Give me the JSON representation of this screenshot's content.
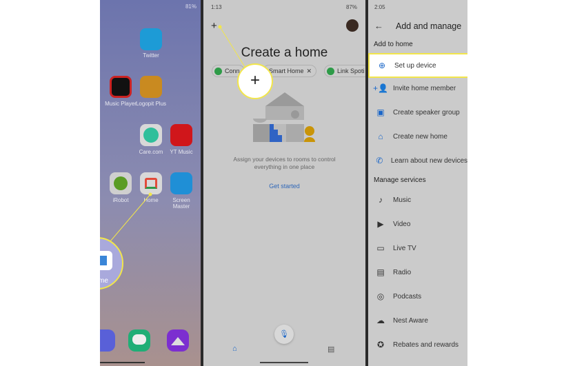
{
  "panel1": {
    "status": "81%",
    "apps": [
      {
        "label": "Twitter",
        "color": "#1d9bd6",
        "glyph": "🐦"
      },
      {
        "label": "Music Player",
        "color": "#111",
        "glyph": "▷"
      },
      {
        "label": "Logopit Plus",
        "color": "#c98a20",
        "glyph": "L"
      },
      {
        "label": "Care.com",
        "color": "#d8d8d8",
        "glyph": "☾"
      },
      {
        "label": "YT Music",
        "color": "#d0161b",
        "glyph": "▶"
      },
      {
        "label": "iRobot",
        "color": "#cfcfcf",
        "glyph": "R"
      },
      {
        "label": "Home",
        "color": "#d8d8d8",
        "glyph": "⌂"
      },
      {
        "label": "Screen Master",
        "color": "#1f8fd6",
        "glyph": "✎"
      }
    ],
    "magnified_label": "me"
  },
  "panel2": {
    "time": "1:13",
    "battery": "87%",
    "title": "Create a home",
    "chips": [
      "Conn",
      "Smart Home",
      "Link Spoti"
    ],
    "description": "Assign your devices to rooms to control everything in one place",
    "cta": "Get started"
  },
  "panel3": {
    "time": "2:05",
    "title": "Add and manage",
    "section1": "Add to home",
    "add_items": [
      {
        "label": "Set up device",
        "icon": "plus-circle-icon"
      },
      {
        "label": "Invite home member",
        "icon": "person-add-icon"
      },
      {
        "label": "Create speaker group",
        "icon": "speaker-group-icon"
      },
      {
        "label": "Create new home",
        "icon": "home-icon"
      },
      {
        "label": "Learn about new devices",
        "icon": "phone-icon"
      }
    ],
    "section2": "Manage services",
    "service_items": [
      {
        "label": "Music",
        "icon": "music-note-icon"
      },
      {
        "label": "Video",
        "icon": "video-icon"
      },
      {
        "label": "Live TV",
        "icon": "live-tv-icon"
      },
      {
        "label": "Radio",
        "icon": "radio-icon"
      },
      {
        "label": "Podcasts",
        "icon": "podcasts-icon"
      },
      {
        "label": "Nest Aware",
        "icon": "nest-aware-icon"
      },
      {
        "label": "Rebates and rewards",
        "icon": "rewards-icon"
      }
    ]
  },
  "colors": {
    "highlight": "#f2e64a",
    "accent": "#1a66c8"
  }
}
